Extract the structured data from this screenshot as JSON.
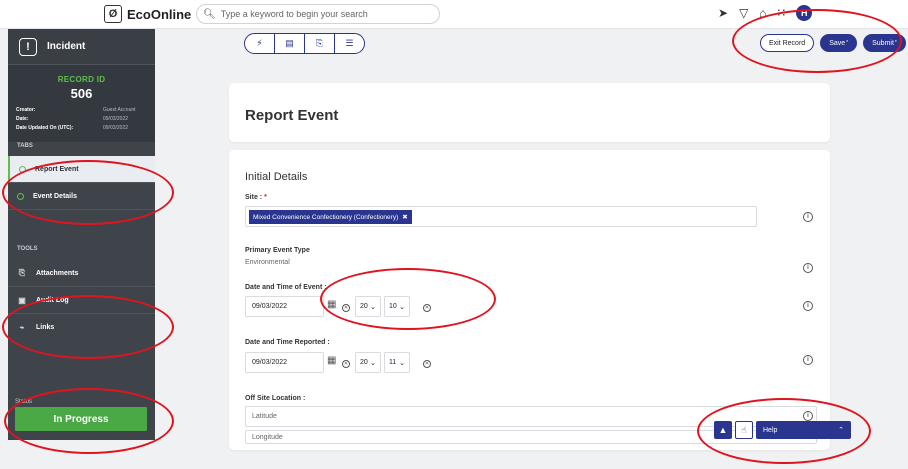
{
  "topbar": {
    "brand": "EcoOnline",
    "search_placeholder": "Type a keyword to begin your search",
    "avatar_initial": "H"
  },
  "sidebar": {
    "module_title": "Incident",
    "record_label": "RECORD ID",
    "record_id": "506",
    "meta": [
      {
        "label": "Creator:",
        "value": "Guest Account"
      },
      {
        "label": "Date:",
        "value": "09/03/2022"
      },
      {
        "label": "Date Updated On (UTC):",
        "value": "09/03/2022"
      }
    ],
    "tabs_header": "TABS",
    "tabs": [
      {
        "label": "Report Event",
        "active": true
      },
      {
        "label": "Event Details",
        "active": false
      }
    ],
    "tools_header": "TOOLS",
    "tools": [
      {
        "label": "Attachments",
        "icon": "paperclip-icon"
      },
      {
        "label": "Audit Log",
        "icon": "save-icon"
      },
      {
        "label": "Links",
        "icon": "link-icon"
      }
    ],
    "status_label": "Status",
    "status_value": "In Progress"
  },
  "actions": {
    "exit_label": "Exit Record",
    "save_label": "Save",
    "submit_label": "Submit",
    "asterisk": "*"
  },
  "page": {
    "title": "Report Event",
    "section_title": "Initial Details"
  },
  "form": {
    "site_label": "Site :",
    "required_mark": "*",
    "site_tag": "Mixed Convenience Confectionery (Confectionery)",
    "primary_event_type_label": "Primary Event Type",
    "primary_event_type_value": "Environmental",
    "event_datetime_label": "Date and Time of Event :",
    "event_date": "09/03/2022",
    "event_hour": "20",
    "event_minute": "10",
    "reported_datetime_label": "Date and Time Reported :",
    "reported_date": "09/03/2022",
    "reported_hour": "20",
    "reported_minute": "11",
    "off_site_label": "Off Site Location :",
    "latitude_placeholder": "Latitude",
    "longitude_placeholder": "Longitude"
  },
  "help": {
    "label": "Help"
  },
  "colors": {
    "accent": "#2a3590",
    "status_green": "#4aa845",
    "annotation_red": "#e0141e"
  }
}
